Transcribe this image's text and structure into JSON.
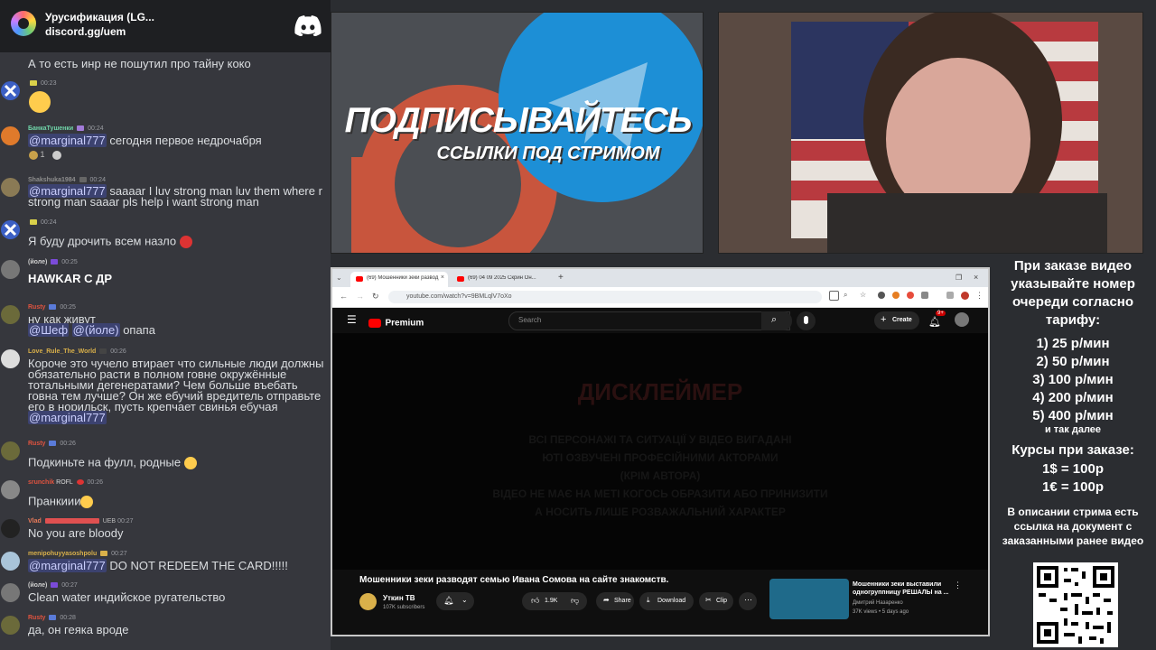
{
  "discord": {
    "server_name": "Урусификация (LG...",
    "invite": "discord.gg/uem",
    "messages": [
      {
        "user": "",
        "time": "",
        "text": "А то есть инр не пошутил про тайну коко"
      },
      {
        "user": "",
        "time": "00:23",
        "text": ""
      },
      {
        "user": "БанкаТушенки",
        "time": "00:24",
        "mention": "@marginal777",
        "text": "сегодня первое недрочабря",
        "reaction_count": "1"
      },
      {
        "user": "Shakshuka1984",
        "time": "00:24",
        "mention": "@marginal777",
        "text": "saaaar I luv strong man luv them where r strong man saaar pls help i want strong man"
      },
      {
        "user": "",
        "time": "00:24",
        "text": "Я буду дрочить всем назло"
      },
      {
        "user": "(йоле)",
        "time": "00:25",
        "text": "HAWKAR С ДР"
      },
      {
        "user": "Rusty",
        "time": "00:25",
        "text": "ну как живут",
        "mention": "@Шеф",
        "mention2": "@(йоле)",
        "text2": "опапа"
      },
      {
        "user": "Love_Rule_The_World",
        "time": "00:26",
        "text": "Короче это чучело втирает что сильные люди должны обязательно расти в полном говне окружённые тотальными дегенератами? Чем больше въебать говна тем лучше? Он же ебучий вредитель отправьте его в норильск, пусть крепчает свинья ебучая",
        "mention": "@marginal777"
      },
      {
        "user": "Rusty",
        "time": "00:26",
        "text": "Подкиньте на фулл, родные"
      },
      {
        "user": "srunchik",
        "badge": "ROFL",
        "time": "00:26",
        "text": "Пранкиии"
      },
      {
        "user": "Vlad",
        "badge2": "UEB",
        "time": "00:27",
        "text": "No you are bloody"
      },
      {
        "user": "menipohuyyasoshpolu",
        "time": "00:27",
        "mention": "@marginal777",
        "text": "DO NOT REDEEM THE CARD!!!!!"
      },
      {
        "user": "(йоле)",
        "time": "00:27",
        "text": "Clean water индийское ругательство"
      },
      {
        "user": "Rusty",
        "time": "00:28",
        "text": "да, он геяка вроде"
      }
    ]
  },
  "promo": {
    "title": "ПОДПИСЫВАЙТЕСЬ",
    "subtitle": "ССЫЛКИ ПОД СТРИМОМ"
  },
  "browser": {
    "tabs": [
      {
        "label": "(69) Мошенники зеки развод"
      },
      {
        "label": "(69) 04 09 2025 Скрин Он..."
      }
    ],
    "url": "youtube.com/watch?v=9BMLqlV7oXo",
    "search_placeholder": "Search",
    "create_label": "Create",
    "notif_count": "9+",
    "logo_text": "Premium",
    "video_overlay": {
      "title": "ДИСКЛЕЙМЕР",
      "lines": [
        "ВСІ ПЕРСОНАЖІ ТА СИТУАЦІЇ У ВІДЕО ВИГАДАНІ",
        "ЮТІ ОЗВУЧЕНІ ПРОФЕСІЙНИМИ АКТОРАМИ",
        "(КРІМ АВТОРА)",
        "ВІДЕО НЕ МАЄ НА МЕТІ КОГОСЬ ОБРАЗИТИ АБО ПРИНИЗИТИ",
        "А НОСИТЬ ЛИШЕ РОЗВАЖАЛЬНИЙ ХАРАКТЕР"
      ]
    },
    "video_title": "Мошенники зеки разводят семью Ивана Сомова на сайте знакомств.",
    "channel_name": "Уткин ТВ",
    "subscribers": "107K subscribers",
    "likes": "1.9K",
    "share_label": "Share",
    "download_label": "Download",
    "clip_label": "Clip",
    "related": {
      "title": "Мошенники зеки выставили одногруппницу РЕШАЛЫ на ...",
      "channel": "Дмитрий Назаренко",
      "meta": "37K views • 5 days ago"
    }
  },
  "info": {
    "order_text": "При заказе видео указывайте номер очереди согласно тарифу:",
    "tariffs": [
      "1) 25 р/мин",
      "2) 50 р/мин",
      "3) 100 р/мин",
      "4) 200 р/мин",
      "5) 400 р/мин"
    ],
    "etc": "и так далее",
    "rates_title": "Курсы при заказе:",
    "rate_usd": "1$ = 100р",
    "rate_eur": "1€ = 100р",
    "desc": "В описании стрима есть ссылка на документ с заказанными ранее видео"
  }
}
